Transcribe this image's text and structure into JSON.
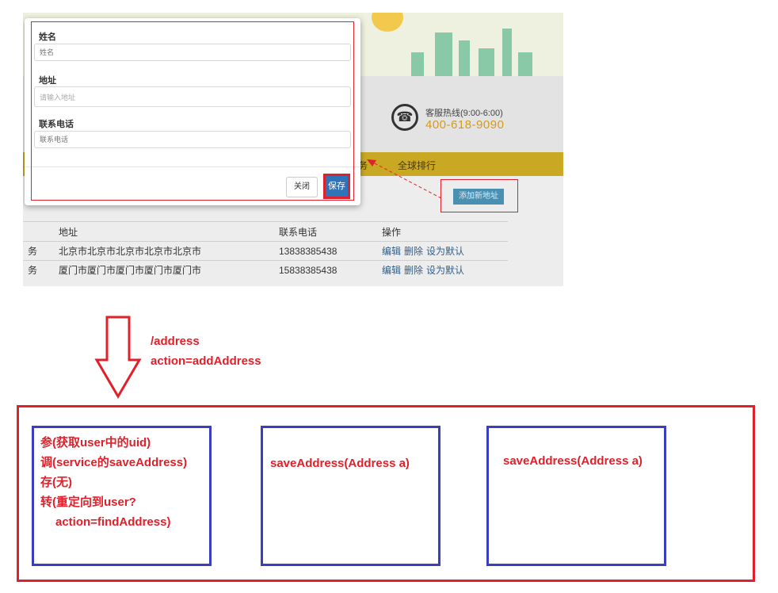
{
  "modal": {
    "name_label": "姓名",
    "name_placeholder": "姓名",
    "address_label": "地址",
    "address_placeholder": "请输入地址",
    "phone_label": "联系电话",
    "phone_placeholder": "联系电话",
    "close_label": "关闭",
    "save_label": "保存"
  },
  "header": {
    "hotline_label": "客服热线(9:00-6:00)",
    "hotline_number": "400-618-9090",
    "hotline_icon": "phone-icon"
  },
  "nav": {
    "item_partial": "务",
    "item_ranking": "全球排行"
  },
  "add_address_label": "添加新地址",
  "table": {
    "headers": [
      "",
      "地址",
      "联系电话",
      "操作"
    ],
    "rows": [
      {
        "name": "务",
        "address": "北京市北京市北京市北京市北京市",
        "phone": "13838385438",
        "ops": [
          "编辑",
          "删除",
          "设为默认"
        ]
      },
      {
        "name": "务",
        "address": "厦门市厦门市厦门市厦门市厦门市",
        "phone": "15838385438",
        "ops": [
          "编辑",
          "删除",
          "设为默认"
        ]
      }
    ]
  },
  "diagram": {
    "route_line1": "/address",
    "route_line2": "action=addAddress",
    "box1": [
      "参(获取user中的uid)",
      "调(service的saveAddress)",
      "存(无)",
      "转(重定向到user?",
      "action=findAddress)"
    ],
    "box2": "saveAddress(Address a)",
    "box3": "saveAddress(Address a)"
  },
  "colors": {
    "annotation_red": "#e0202a",
    "box_blue": "#3a3fc0",
    "nav_yellow": "#c9a824",
    "button_blue": "#2f73b8"
  }
}
